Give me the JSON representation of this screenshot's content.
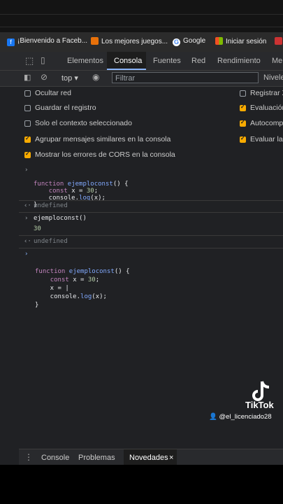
{
  "bookmarks": [
    {
      "label": "¡Bienvenido a Faceb...",
      "icon": "facebook-icon",
      "color": "#1877f2"
    },
    {
      "label": "Los mejores juegos...",
      "icon": "game-icon",
      "color": "#e8710a"
    },
    {
      "label": "Google",
      "icon": "google-icon",
      "color": "#ffffff"
    },
    {
      "label": "Iniciar sesión",
      "icon": "microsoft-icon",
      "color": "#f25022"
    },
    {
      "label": "",
      "icon": "bookmark-icon",
      "color": "#cc3333"
    }
  ],
  "devtools_tabs": [
    "Elementos",
    "Consola",
    "Fuentes",
    "Red",
    "Rendimiento",
    "Me"
  ],
  "active_tab": "Consola",
  "toolbar": {
    "context": "top",
    "filter_placeholder": "Filtrar",
    "levels": "Nivele"
  },
  "settings_left": [
    {
      "label": "Ocultar red",
      "checked": false
    },
    {
      "label": "Guardar el registro",
      "checked": false
    },
    {
      "label": "Solo el contexto seleccionado",
      "checked": false
    },
    {
      "label": "Agrupar mensajes similares en la consola",
      "checked": true
    },
    {
      "label": "Mostrar los errores de CORS en la consola",
      "checked": true
    }
  ],
  "settings_right": [
    {
      "label": "Registrar X",
      "checked": false
    },
    {
      "label": "Evaluación",
      "checked": true
    },
    {
      "label": "Autocomp",
      "checked": true
    },
    {
      "label": "Evaluar la",
      "checked": true
    }
  ],
  "console": {
    "entry1": [
      "function ejemploconst() {",
      "    const x = 30;",
      "    console.log(x);",
      "}"
    ],
    "result1": "undefined",
    "entry2": "ejemploconst()",
    "output2": "30",
    "result2": "undefined",
    "entry3": [
      "function ejemploconst() {",
      "    const x = 30;",
      "    x = |",
      "    console.log(x);",
      "}"
    ]
  },
  "drawer_tabs": [
    "Console",
    "Problemas",
    "Novedades"
  ],
  "drawer_close": "×",
  "watermark": {
    "brand": "TikTok",
    "user": "@el_licenciado28"
  },
  "colors": {
    "accent_tab": "#8ab4f8",
    "checkbox_on": "#f9ab00"
  }
}
